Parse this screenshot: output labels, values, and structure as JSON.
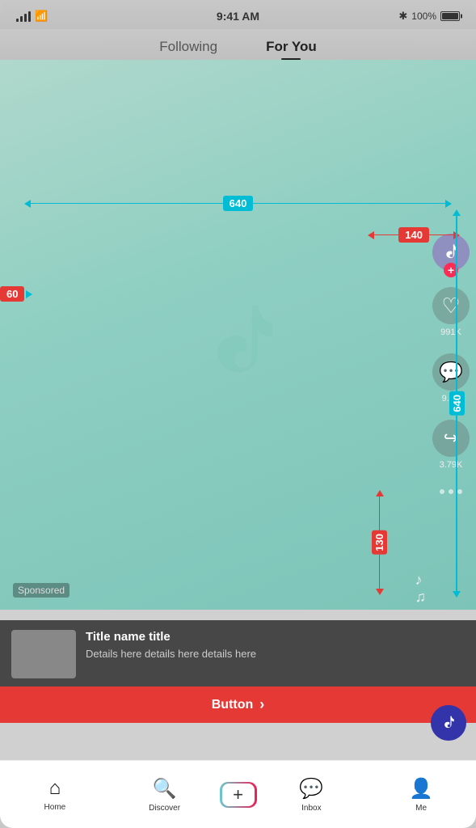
{
  "statusBar": {
    "time": "9:41 AM",
    "battery": "100%"
  },
  "tabs": {
    "following": "Following",
    "forYou": "For You",
    "activeTab": "forYou"
  },
  "annotations": {
    "width640": "640",
    "height640": "640",
    "left60": "60",
    "right140": "140",
    "bottom130": "130"
  },
  "actionButtons": {
    "likes": "991K",
    "comments": "9.8K",
    "shares": "3.79K"
  },
  "adCard": {
    "sponsored": "Sponsored",
    "title": "Title name title",
    "details": "Details here details here details here",
    "buttonText": "Button",
    "buttonChevron": "›"
  },
  "bottomNav": {
    "home": "Home",
    "discover": "Discover",
    "post": "+",
    "inbox": "Inbox",
    "me": "Me"
  }
}
